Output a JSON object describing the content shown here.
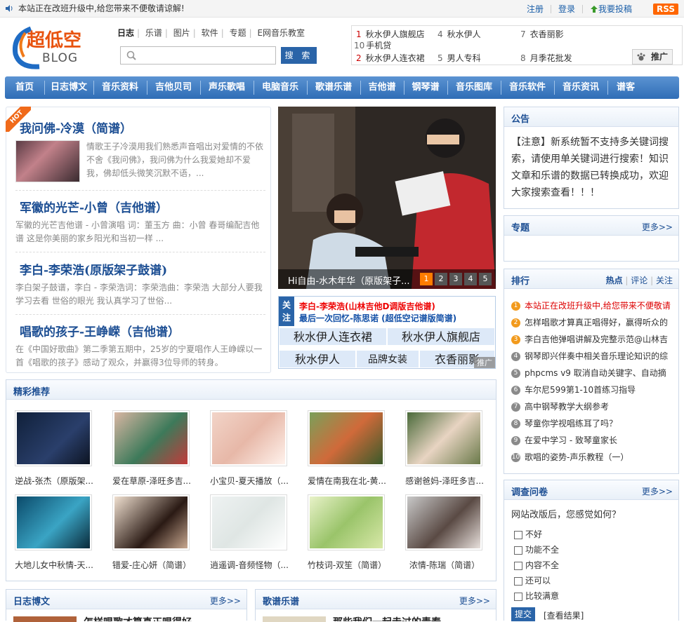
{
  "topbar": {
    "notice": "本站正在改班升级中,给您带来不便敬请谅解!",
    "links": [
      "注册",
      "登录",
      "我要投稿"
    ],
    "rss": "RSS"
  },
  "logo": {
    "name": "超低空",
    "sub": "BLOG"
  },
  "categories": [
    "日志",
    "乐谱",
    "图片",
    "软件",
    "专题",
    "E网音乐教室"
  ],
  "search": {
    "placeholder": "",
    "button": "搜 索"
  },
  "hot_keywords": [
    {
      "n": "1",
      "t": "秋水伊人旗舰店"
    },
    {
      "n": "4",
      "t": "秋水伊人"
    },
    {
      "n": "7",
      "t": "衣香丽影"
    },
    {
      "n": "10",
      "t": "手机贷"
    },
    {
      "n": "2",
      "t": "秋水伊人连衣裙"
    },
    {
      "n": "5",
      "t": "男人专科"
    },
    {
      "n": "8",
      "t": "月季花批发"
    }
  ],
  "promo_button": "推广",
  "nav": [
    "首页",
    "日志博文",
    "音乐资料",
    "吉他贝司",
    "声乐歌唱",
    "电脑音乐",
    "歌谱乐谱",
    "吉他谱",
    "钢琴谱",
    "音乐图库",
    "音乐软件",
    "音乐资讯",
    "谱客"
  ],
  "featured": [
    {
      "title": "我问佛-冷漠（简谱）",
      "desc": "情歌王子冷漠用我们熟悉声音唱出对爱情的不依不舍《我问佛》，我问佛为什么我爱她却不爱我，佛却低头微笑沉默不语，..."
    },
    {
      "title": "军徽的光芒-小曾（吉他谱）",
      "desc": "军徽的光芒吉他谱 - 小曾演唱 词：董玉方 曲：小曾 春哥编配吉他谱 这是你美丽的家乡阳光和当初一样 ..."
    },
    {
      "title": "李白-李荣浩(原版架子鼓谱)",
      "desc": "李白架子鼓谱，李白 - 李荣浩词：李荣浩曲：李荣浩 大部分人要我学习去看 世俗的眼光 我认真学习了世俗..."
    },
    {
      "title": "唱歌的孩子-王峥嵘（吉他谱）",
      "desc": "在《中国好歌曲》第二季第五期中，25岁的宁夏唱作人王峥嵘以一首《唱歌的孩子》感动了观众，并赢得3位导师的转身。"
    }
  ],
  "hot_badge": "HOT",
  "slideshow": {
    "caption": "Hi自由-水木年华（原版架子...",
    "pages": [
      "1",
      "2",
      "3",
      "4",
      "5"
    ],
    "current": "1"
  },
  "guanzhu": {
    "label": "关注",
    "line1": "李白-李荣浩(山林吉他D调版吉他谱)",
    "line2": "最后一次回忆-陈思诺 (超低空记谱版简谱)",
    "cells": [
      "秋水伊人连衣裙",
      "秋水伊人旗舰店",
      "秋水伊人",
      "品牌女装",
      "衣香丽影"
    ],
    "ad_tag": "推广"
  },
  "notice_box": {
    "title": "公告",
    "text": "【注意】新系统暂不支持多关键词搜索，请使用单关键词进行搜索！知识文章和乐谱的数据已转换成功，欢迎大家搜索查看！！！"
  },
  "topic_box": {
    "title": "专题",
    "more": "更多>>"
  },
  "rank_box": {
    "title": "排行",
    "tabs": [
      "热点",
      "评论",
      "关注"
    ],
    "items": [
      {
        "n": "1",
        "t": "本站正在改班升级中,给您带来不便敬请",
        "hot": true
      },
      {
        "n": "2",
        "t": "怎样唱歌才算真正唱得好，赢得听众的",
        "hot": true
      },
      {
        "n": "3",
        "t": "李白吉他弹唱讲解及完整示范@山林吉",
        "hot": true
      },
      {
        "n": "4",
        "t": "钢琴即兴伴奏中相关音乐理论知识的综",
        "hot": false
      },
      {
        "n": "5",
        "t": "phpcms v9 取消自动关键字、自动摘",
        "hot": false
      },
      {
        "n": "6",
        "t": "车尔尼599第1-10首练习指导",
        "hot": false
      },
      {
        "n": "7",
        "t": "高中钢琴教学大纲参考",
        "hot": false
      },
      {
        "n": "8",
        "t": "琴童你学视唱练耳了吗？",
        "hot": false
      },
      {
        "n": "9",
        "t": "在爱中学习 - 致琴童家长",
        "hot": false
      },
      {
        "n": "10",
        "t": "歌唱的姿势-声乐教程（一）",
        "hot": false
      }
    ]
  },
  "recommend": {
    "title": "精彩推荐",
    "items": [
      "逆战-张杰（原版架...",
      "爱在草原-泽旺多吉...",
      "小宝贝-夏天播放（...",
      "爱情在南我在北-黄...",
      "感谢爸妈-泽旺多吉...",
      "大地儿女中秋情-天...",
      "错爱-庄心妍（简谱）",
      "逍遥调-音频怪物（...",
      "竹枝词-双笙（简谱）",
      "浓情-陈瑞（简谱）"
    ]
  },
  "survey": {
    "title": "调查问卷",
    "more": "更多>>",
    "question": "网站改版后，您感觉如何？",
    "options": [
      "不好",
      "功能不全",
      "内容不全",
      "还可以",
      "比较满意"
    ],
    "submit": "提交",
    "result": "[查看结果]"
  },
  "blog_box": {
    "title": "日志博文",
    "more": "更多>>",
    "first": "怎样唱歌才算真正唱得好"
  },
  "score_box": {
    "title": "歌谱乐谱",
    "more": "更多>>",
    "first": "那些我们一起走过的青春"
  }
}
